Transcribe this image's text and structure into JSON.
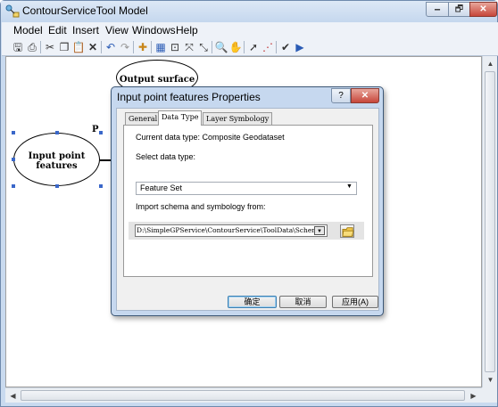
{
  "window": {
    "title": "ContourServiceTool Model",
    "minimize": "🗕",
    "maximize": "🗗",
    "close": "✕"
  },
  "menu": [
    "Model",
    "Edit",
    "Insert",
    "View",
    "Windows",
    "Help"
  ],
  "toolbar": {
    "icons": [
      "save-icon",
      "print-icon",
      "cut-icon",
      "copy-icon",
      "paste-icon",
      "delete-icon",
      "undo-icon",
      "redo-icon",
      "add-data-icon",
      "auto-layout-icon",
      "full-extent-icon",
      "zoom-in-fixed-icon",
      "zoom-out-fixed-icon",
      "zoom-icon",
      "pan-icon",
      "select-icon",
      "connect-icon",
      "validate-icon",
      "run-icon"
    ]
  },
  "canvas": {
    "output_label": "Output surface",
    "input_label": "Input point features",
    "param_marker": "P"
  },
  "dialog": {
    "title": "Input point features Properties",
    "help": "?",
    "close": "✕",
    "tabs": [
      "General",
      "Data Type",
      "Layer Symbology"
    ],
    "active_tab": "Data Type",
    "current_type_label": "Current data type: Composite Geodataset",
    "select_label": "Select data type:",
    "selected_type": "Feature Set",
    "import_label": "Import schema and symbology from:",
    "import_path": "D:\\SimpleGPService\\ContourService\\ToolData\\Schema",
    "ok": "确定",
    "cancel": "取消",
    "apply": "应用(A)"
  }
}
